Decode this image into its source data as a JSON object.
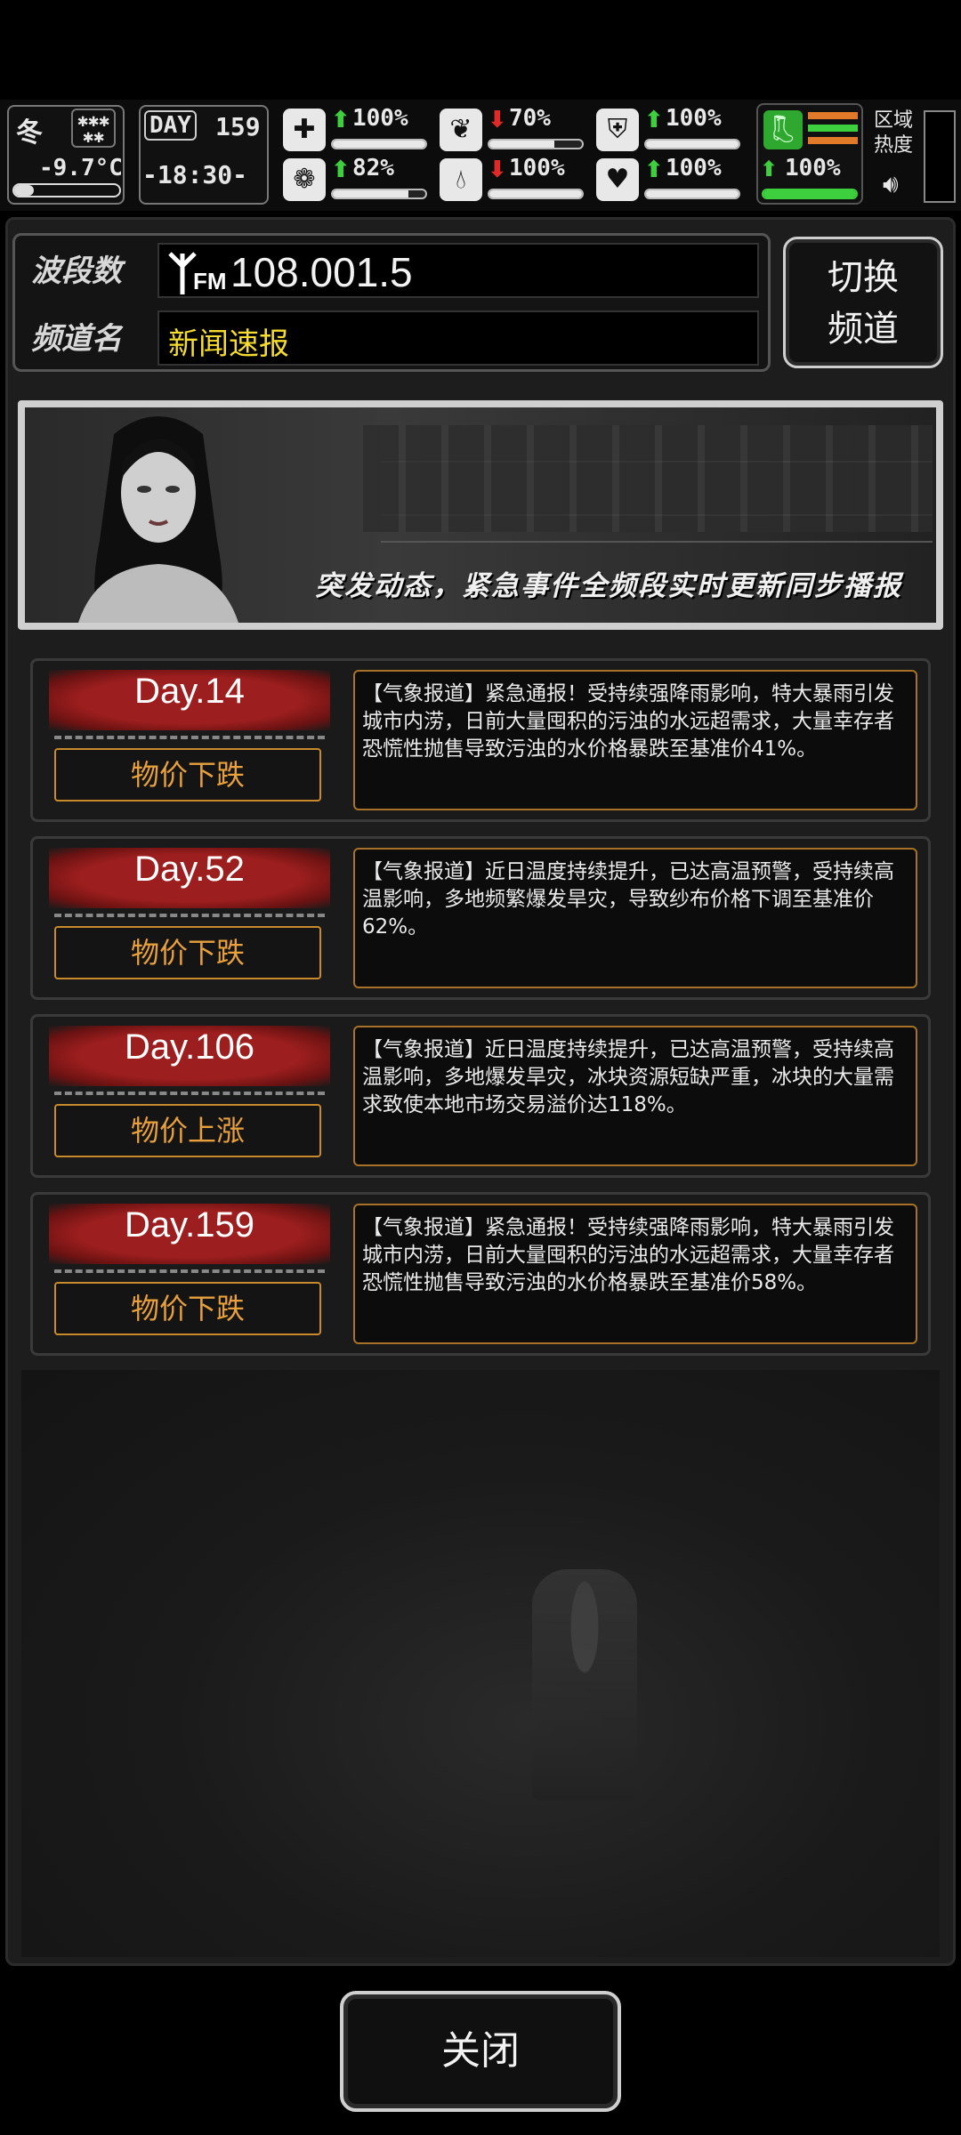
{
  "hud": {
    "season": "冬",
    "weather_glyphs": "***\n**",
    "temperature": "-9.7°C",
    "day_label": "DAY",
    "day_number": "159",
    "clock": "-18:30-",
    "stats": [
      {
        "icon": "medkit-icon",
        "arrow": "up",
        "value": "100%",
        "fill": 1.0
      },
      {
        "icon": "stomach-icon",
        "arrow": "down",
        "value": "70%",
        "fill": 0.7
      },
      {
        "icon": "shield-icon",
        "arrow": "up",
        "value": "100%",
        "fill": 1.0
      },
      {
        "icon": "brain-icon",
        "arrow": "up",
        "value": "82%",
        "fill": 0.82
      },
      {
        "icon": "water-drop-icon",
        "arrow": "down",
        "value": "100%",
        "fill": 1.0
      },
      {
        "icon": "heart-icon",
        "arrow": "up",
        "value": "100%",
        "fill": 1.0
      }
    ],
    "stamina": {
      "icon": "boot-icon",
      "arrow": "up",
      "value": "100%",
      "fill": 1.0
    },
    "region_heat_label": "区域\n热度"
  },
  "radio": {
    "band_label": "波段数",
    "band_value": "108.001.5",
    "fm_label": "FM",
    "channel_label": "频道名",
    "channel_value": "新闻速报",
    "switch_button": "切换\n频道"
  },
  "banner": {
    "caption": "突发动态，紧急事件全频段实时更新同步播报"
  },
  "news": [
    {
      "day": "Day.14",
      "tag": "物价下跌",
      "text": "【气象报道】紧急通报！受持续强降雨影响，特大暴雨引发城市内涝，日前大量囤积的污浊的水远超需求，大量幸存者恐慌性抛售导致污浊的水价格暴跌至基准价41%。"
    },
    {
      "day": "Day.52",
      "tag": "物价下跌",
      "text": "【气象报道】近日温度持续提升，已达高温预警，受持续高温影响，多地频繁爆发旱灾，导致纱布价格下调至基准价62%。"
    },
    {
      "day": "Day.106",
      "tag": "物价上涨",
      "text": "【气象报道】近日温度持续提升，已达高温预警，受持续高温影响，多地爆发旱灾，冰块资源短缺严重，冰块的大量需求致使本地市场交易溢价达118%。"
    },
    {
      "day": "Day.159",
      "tag": "物价下跌",
      "text": "【气象报道】紧急通报！受持续强降雨影响，特大暴雨引发城市内涝，日前大量囤积的污浊的水远超需求，大量幸存者恐慌性抛售导致污浊的水价格暴跌至基准价58%。"
    }
  ],
  "close_button": "关闭",
  "colors": {
    "channel_text": "#f5dc2e",
    "price_tag_text": "#e8a03c",
    "day_brush": "#9d1e1e",
    "up_arrow": "#3ecf3e",
    "down_arrow": "#e02a2a"
  }
}
